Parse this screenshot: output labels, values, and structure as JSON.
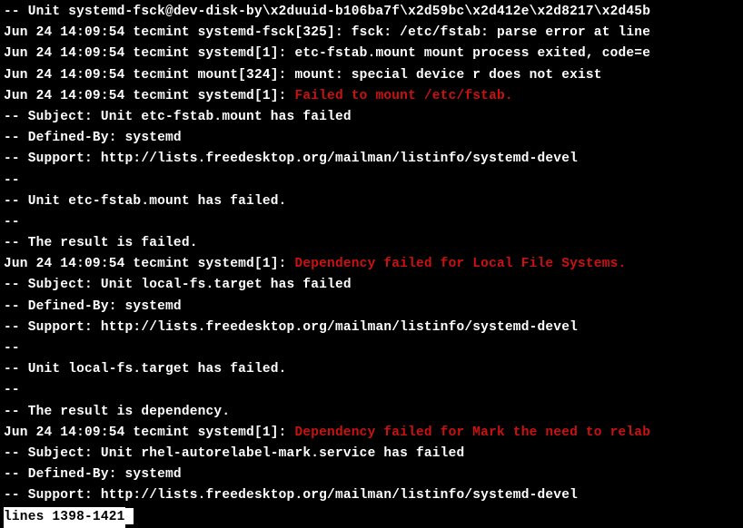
{
  "lines": {
    "l0": "-- Unit systemd-fsck@dev-disk-by\\x2duuid-b106ba7f\\x2d59bc\\x2d412e\\x2d8217\\x2d45b",
    "l1": "Jun 24 14:09:54 tecmint systemd-fsck[325]: fsck: /etc/fstab: parse error at line",
    "l2": "Jun 24 14:09:54 tecmint systemd[1]: etc-fstab.mount mount process exited, code=e",
    "l3": "Jun 24 14:09:54 tecmint mount[324]: mount: special device r does not exist",
    "l4a": "Jun 24 14:09:54 tecmint systemd[1]: ",
    "l4b": "Failed to mount /etc/fstab.",
    "l5": "-- Subject: Unit etc-fstab.mount has failed",
    "l6": "-- Defined-By: systemd",
    "l7": "-- Support: http://lists.freedesktop.org/mailman/listinfo/systemd-devel",
    "l8": "--",
    "l9": "-- Unit etc-fstab.mount has failed.",
    "l10": "--",
    "l11": "-- The result is failed.",
    "l12a": "Jun 24 14:09:54 tecmint systemd[1]: ",
    "l12b": "Dependency failed for Local File Systems.",
    "l13": "-- Subject: Unit local-fs.target has failed",
    "l14": "-- Defined-By: systemd",
    "l15": "-- Support: http://lists.freedesktop.org/mailman/listinfo/systemd-devel",
    "l16": "--",
    "l17": "-- Unit local-fs.target has failed.",
    "l18": "--",
    "l19": "-- The result is dependency.",
    "l20a": "Jun 24 14:09:54 tecmint systemd[1]: ",
    "l20b": "Dependency failed for Mark the need to relab",
    "l21": "-- Subject: Unit rhel-autorelabel-mark.service has failed",
    "l22": "-- Defined-By: systemd",
    "l23": "-- Support: http://lists.freedesktop.org/mailman/listinfo/systemd-devel",
    "status": "lines 1398-1421"
  }
}
